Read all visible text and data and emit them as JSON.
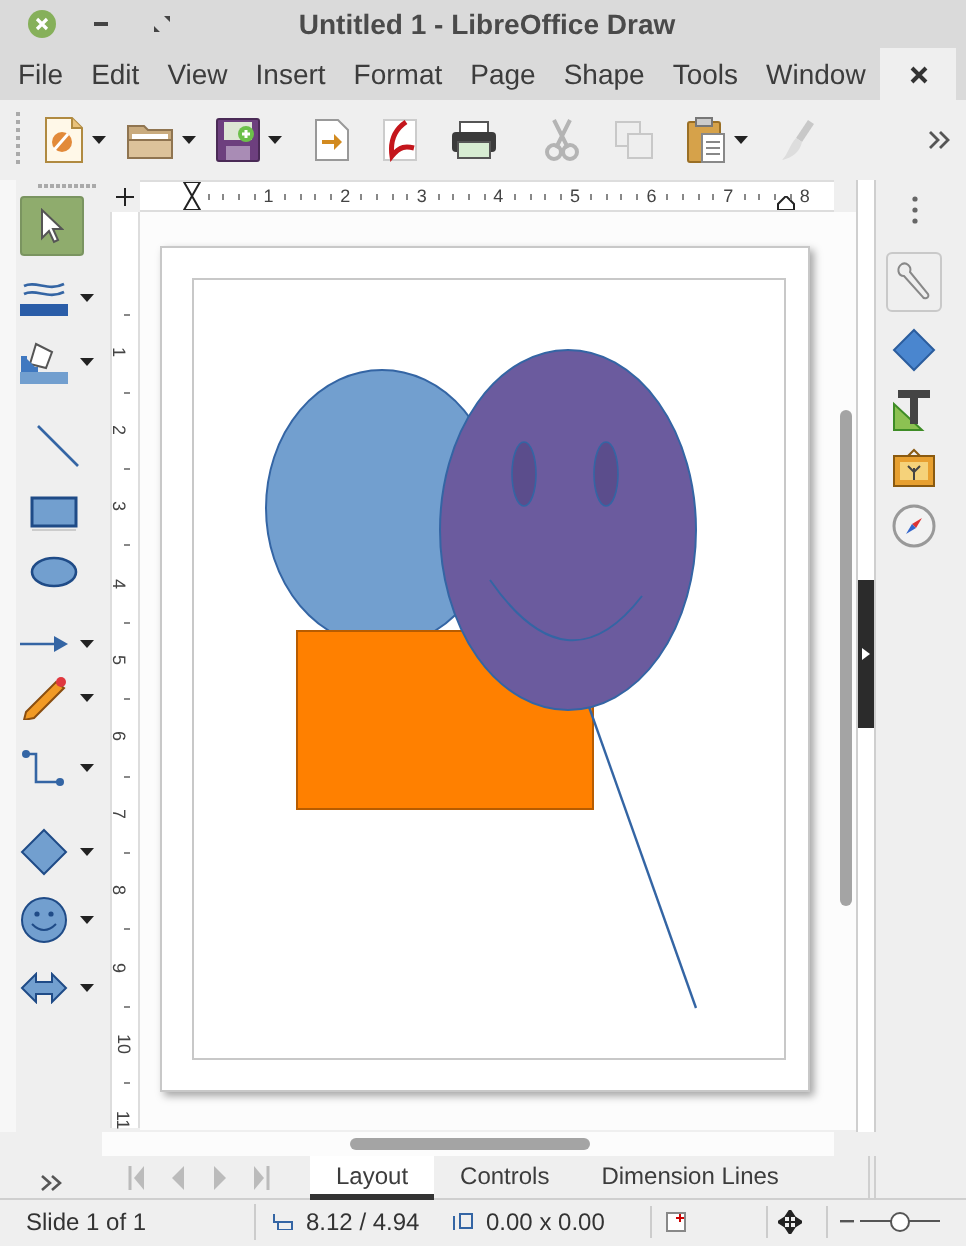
{
  "window": {
    "title": "Untitled 1 - LibreOffice Draw"
  },
  "menu": [
    "File",
    "Edit",
    "View",
    "Insert",
    "Format",
    "Page",
    "Shape",
    "Tools",
    "Window"
  ],
  "ruler_horizontal": [
    "1",
    "2",
    "3",
    "4",
    "5",
    "6",
    "7",
    "8"
  ],
  "ruler_vertical": [
    "1",
    "2",
    "3",
    "4",
    "5",
    "6",
    "7",
    "8",
    "9",
    "10",
    "11"
  ],
  "tabs": [
    {
      "label": "Layout",
      "selected": true
    },
    {
      "label": "Controls",
      "selected": false
    },
    {
      "label": "Dimension Lines",
      "selected": false
    }
  ],
  "status_bar": {
    "slide": "Slide 1 of 1",
    "position": "8.12 / 4.94",
    "size": "0.00 x 0.00",
    "zoom": {
      "level": 0.5
    }
  }
}
